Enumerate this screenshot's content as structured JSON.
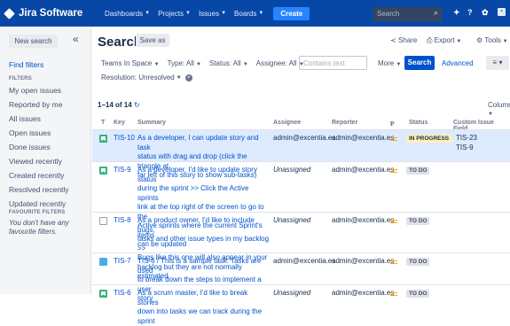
{
  "topbar": {
    "logo_text": "Jira Software",
    "nav": [
      "Dashboards",
      "Projects",
      "Issues",
      "Boards"
    ],
    "create_label": "Create",
    "search_placeholder": "Search"
  },
  "sidebar": {
    "new_search_label": "New search",
    "collapse_glyph": "«",
    "find_filters": "Find filters",
    "filters_title": "FILTERS",
    "filters": [
      "My open issues",
      "Reported by me",
      "All issues",
      "Open issues",
      "Done issues",
      "Viewed recently",
      "Created recently",
      "Resolved recently",
      "Updated recently"
    ],
    "favourite_title": "FAVOURITE FILTERS",
    "favourite_text": "You don't have any favourite filters."
  },
  "header": {
    "title": "Search",
    "save_as_label": "Save as",
    "share_label": "Share",
    "export_label": "Export",
    "tools_label": "Tools"
  },
  "filters": {
    "project": "Teams In Space",
    "type": "Type: All",
    "status": "Status: All",
    "assignee": "Assignee: All",
    "contains_placeholder": "Contains text",
    "more_label": "More",
    "search_label": "Search",
    "advanced_label": "Advanced",
    "resolution": "Resolution: Unresolved"
  },
  "results": {
    "count_text": "1–14 of 14",
    "columns_label": "Columns",
    "headers": {
      "t": "T",
      "key": "Key",
      "summary": "Summary",
      "assignee": "Assignee",
      "reporter": "Reporter",
      "p": "P",
      "status": "Status",
      "custom": "Custom Issue Field"
    },
    "rows": [
      {
        "type": "story",
        "key": "TIS-10",
        "summary": [
          "As a developer, I can update story and task",
          "status with drag and drop (click the triangle at",
          "far left of this story to show sub-tasks)"
        ],
        "assignee": "admin@excentia.es",
        "reporter": "admin@excentia.es",
        "status": "IN PROGRESS",
        "custom": [
          "TIS-23",
          "TIS-9"
        ]
      },
      {
        "type": "story",
        "key": "TIS-9",
        "summary": [
          "As a developer, I'd like to update story status",
          "during the sprint >> Click the Active sprints",
          "link at the top right of the screen to go to the",
          "Active sprints where the current Sprint's items",
          "can be updated"
        ],
        "assignee": "Unassigned",
        "reporter": "admin@excentia.es",
        "status": "TO DO",
        "custom": []
      },
      {
        "type": "bug",
        "key": "TIS-8",
        "summary": [
          "As a product owner, I'd like to include bugs,",
          "tasks and other issue types in my backlog >>",
          "Bugs like this one will also appear in your",
          "backlog but they are not normally estimated"
        ],
        "assignee": "Unassigned",
        "reporter": "admin@excentia.es",
        "status": "TO DO",
        "custom": []
      },
      {
        "type": "task",
        "key": "TIS-7",
        "summary": [
          "TIS-6 / This is a sample task. Tasks are used",
          "to break down the steps to implement a user",
          "story"
        ],
        "assignee": "admin@excentia.es",
        "reporter": "admin@excentia.es",
        "status": "TO DO",
        "custom": []
      },
      {
        "type": "story",
        "key": "TIS-6",
        "summary": [
          "As a scrum master, I'd like to break stories",
          "down into tasks we can track during the sprint"
        ],
        "assignee": "Unassigned",
        "reporter": "admin@excentia.es",
        "status": "TO DO",
        "custom": []
      }
    ]
  }
}
